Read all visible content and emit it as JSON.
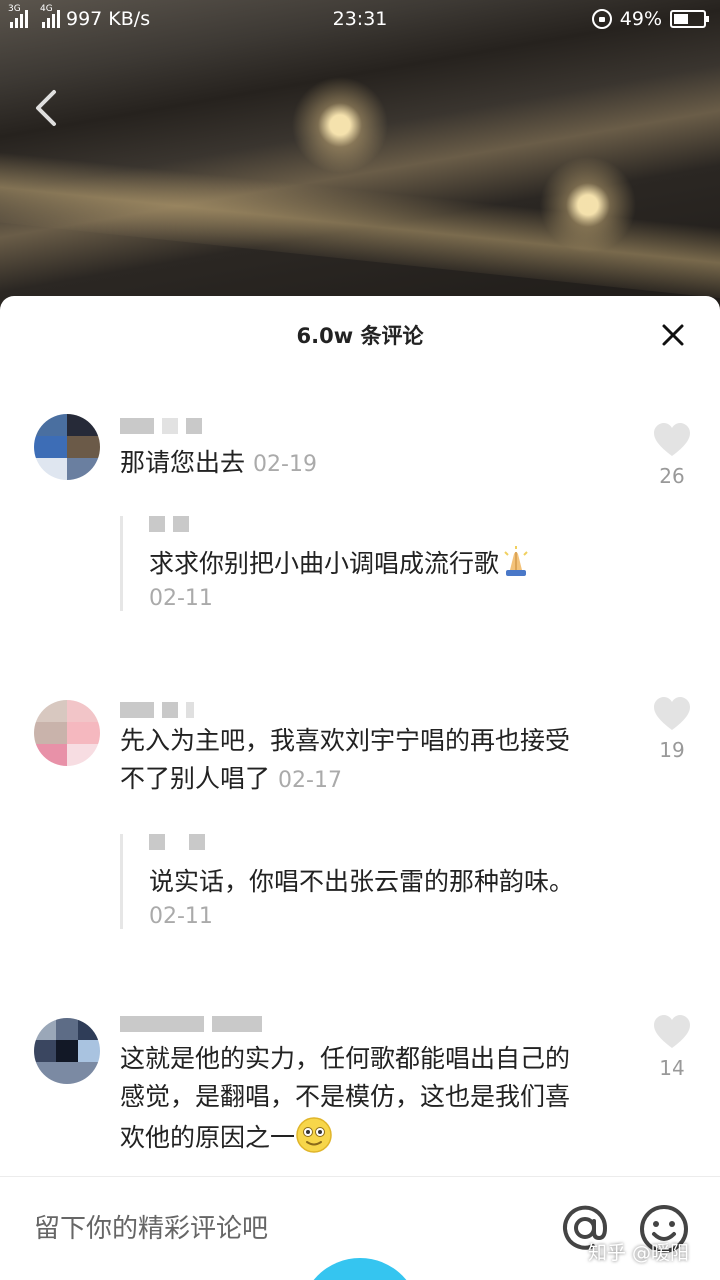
{
  "status_bar": {
    "network_1": "3G",
    "network_2": "4G",
    "speed": "997 KB/s",
    "time": "23:31",
    "battery": "49%",
    "battery_level": 0.49
  },
  "sheet": {
    "title": "6.0w 条评论"
  },
  "comments": [
    {
      "text": "那请您出去",
      "date": "02-19",
      "likes": "26",
      "reply": {
        "text": "求求你别把小曲小调唱成流行歌",
        "date": "02-11"
      }
    },
    {
      "text": "先入为主吧，我喜欢刘宇宁唱的再也接受不了别人唱了",
      "date": "02-17",
      "likes": "19",
      "reply": {
        "text": "说实话，你唱不出张云雷的那种韵味。",
        "date": "02-11"
      }
    },
    {
      "text": "这就是他的实力，任何歌都能唱出自己的感觉，是翻唱，不是模仿，这也是我们喜欢他的原因之一",
      "likes": "14"
    }
  ],
  "input": {
    "placeholder": "留下你的精彩评论吧"
  },
  "watermark": "知乎 @暖阳",
  "colors": {
    "accent": "#35c5f0",
    "like_icon": "#e3e3e3",
    "date_text": "#aaaaaa"
  },
  "icons": [
    "back-arrow",
    "close-x",
    "heart",
    "at-sign",
    "emoji-face",
    "pray-emoji",
    "smile-emoji"
  ]
}
